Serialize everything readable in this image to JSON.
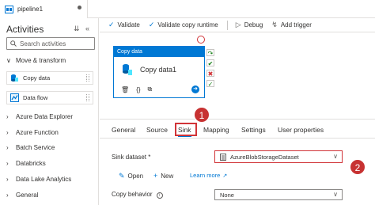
{
  "window": {
    "tab_title": "pipeline1"
  },
  "activities": {
    "title": "Activities",
    "search_placeholder": "Search activities",
    "sections": [
      {
        "label": "Move & transform",
        "expanded": true
      },
      {
        "label": "Azure Data Explorer"
      },
      {
        "label": "Azure Function"
      },
      {
        "label": "Batch Service"
      },
      {
        "label": "Databricks"
      },
      {
        "label": "Data Lake Analytics"
      },
      {
        "label": "General"
      }
    ],
    "items": [
      {
        "label": "Copy data"
      },
      {
        "label": "Data flow"
      }
    ]
  },
  "toolbar": {
    "validate": "Validate",
    "validate_copy_runtime": "Validate copy runtime",
    "debug": "Debug",
    "add_trigger": "Add trigger"
  },
  "canvas": {
    "activity": {
      "type_label": "Copy data",
      "name": "Copy data1"
    }
  },
  "properties": {
    "tabs": [
      "General",
      "Source",
      "Sink",
      "Mapping",
      "Settings",
      "User properties"
    ],
    "active_tab": "Sink",
    "sink_dataset_label": "Sink dataset *",
    "sink_dataset_value": "AzureBlobStorageDataset",
    "open_label": "Open",
    "new_label": "New",
    "learn_more_label": "Learn more",
    "copy_behavior_label": "Copy behavior",
    "copy_behavior_value": "None"
  },
  "annotations": {
    "badge1": "1",
    "badge2": "2"
  },
  "colors": {
    "accent": "#0078d4",
    "highlight": "#d13438",
    "badge": "#c73232"
  }
}
